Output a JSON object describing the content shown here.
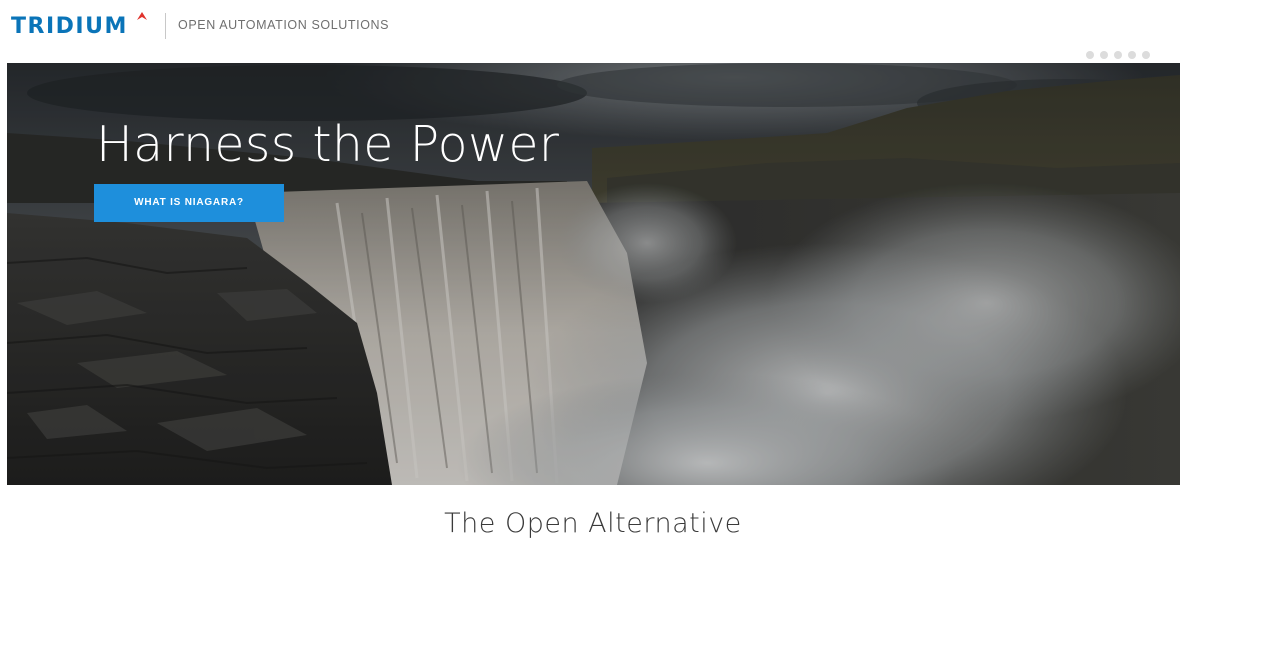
{
  "header": {
    "logo_text": "TRIDIUM",
    "tagline": "OPEN AUTOMATION SOLUTIONS"
  },
  "carousel": {
    "slide_count": 5,
    "active_index": 0
  },
  "hero": {
    "title": "Harness the Power",
    "cta_label": "WHAT IS NIAGARA?"
  },
  "section": {
    "title": "The Open Alternative"
  },
  "colors": {
    "brand_blue": "#0a74b8",
    "brand_red": "#e0312b",
    "cta_blue": "#1e8fdc"
  },
  "icons": {
    "logo_mark": "red-chevron-mark"
  }
}
